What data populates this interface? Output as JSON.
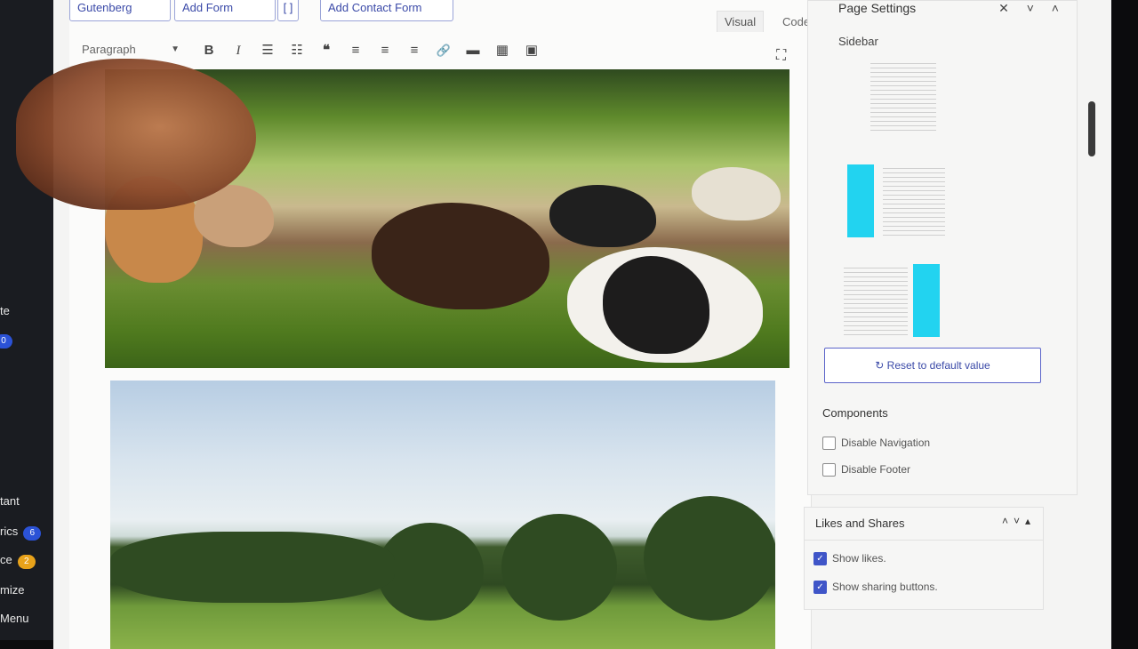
{
  "admin_menu": {
    "items": [
      {
        "label": "te",
        "badge": ""
      },
      {
        "label": "0",
        "badge": ""
      },
      {
        "label": "tant",
        "badge": ""
      },
      {
        "label": "rics",
        "badge": "6"
      },
      {
        "label": "ce",
        "badge": "2"
      },
      {
        "label": "mize",
        "badge": ""
      },
      {
        "label": "Menu",
        "badge": ""
      }
    ]
  },
  "editor": {
    "top_buttons": [
      "Gutenberg",
      "Add Form",
      "[ ]",
      "Add Contact Form"
    ],
    "tabs": {
      "visual": "Visual",
      "code": "Code"
    },
    "format_select": "Paragraph",
    "toolbar_icons": [
      {
        "name": "bold-icon",
        "glyph": "B"
      },
      {
        "name": "italic-icon",
        "glyph": "I"
      },
      {
        "name": "bulleted-list-icon",
        "glyph": "☰"
      },
      {
        "name": "numbered-list-icon",
        "glyph": "☷"
      },
      {
        "name": "blockquote-icon",
        "glyph": "❝"
      },
      {
        "name": "align-left-icon",
        "glyph": "≡"
      },
      {
        "name": "align-center-icon",
        "glyph": "≡"
      },
      {
        "name": "align-right-icon",
        "glyph": "≡"
      },
      {
        "name": "link-icon",
        "glyph": "🔗"
      },
      {
        "name": "read-more-icon",
        "glyph": "▬"
      },
      {
        "name": "keyboard-icon",
        "glyph": "▦"
      },
      {
        "name": "kitchen-sink-icon",
        "glyph": "▣"
      }
    ],
    "fullscreen_icon": "fullscreen-icon"
  },
  "sidebar": {
    "panel_title": "Page Settings",
    "panel_controls": "✕ ˅ ˄",
    "section_label": "Sidebar",
    "reset_button": "Reset to default value",
    "components_label": "Components",
    "components": [
      {
        "label": "Disable Navigation",
        "checked": false
      },
      {
        "label": "Disable Footer",
        "checked": false
      }
    ],
    "accent_color": "#22d3f0"
  },
  "likes_panel": {
    "title": "Likes and Shares",
    "controls": "˄˅▴",
    "options": [
      {
        "label": "Show likes.",
        "checked": true
      },
      {
        "label": "Show sharing buttons.",
        "checked": true
      }
    ]
  },
  "colors": {
    "link_blue": "#3b4aa8",
    "checkbox_blue": "#3f55c8",
    "badge_blue": "#2b52d6",
    "badge_orange": "#e8a21a"
  }
}
